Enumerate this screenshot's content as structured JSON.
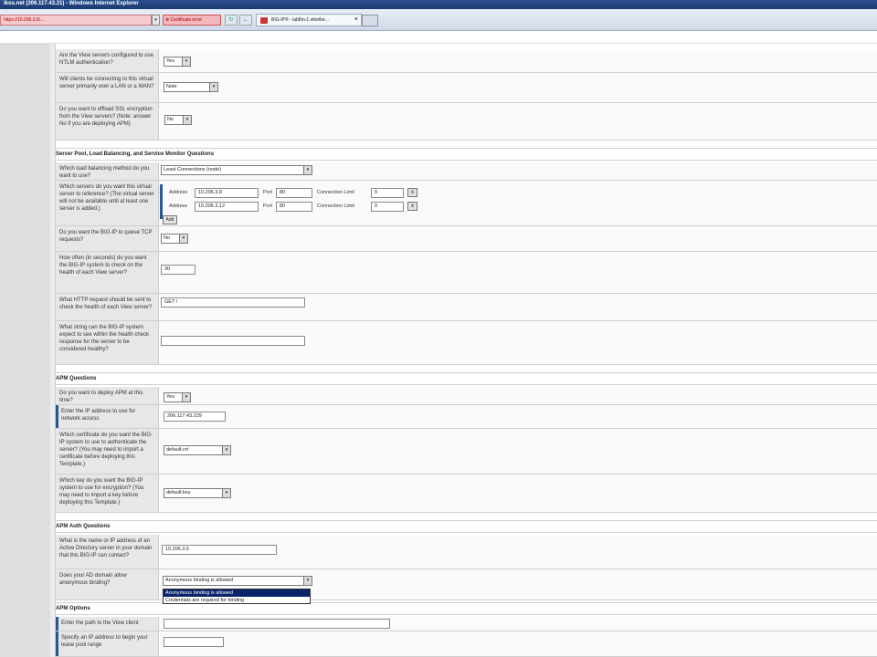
{
  "window": {
    "title": "ikos.net (206.117.43.21) - Windows Internet Explorer"
  },
  "toolbar": {
    "address": "https://10.206.3.5/...",
    "cert_error": "Certificate error",
    "tab_title": "BIG-IP® - lab8m-1.vthelbe...",
    "go_icon": "↻",
    "back_icon": "←"
  },
  "questions": {
    "ntlm": {
      "label": "Are the View servers configured to use NTLM authentication?",
      "value": "Yes"
    },
    "lan_wan": {
      "label": "Will clients be connecting to this virtual server primarily over a LAN or a WAN?",
      "value": "Note"
    },
    "ssl_offload": {
      "label": "Do you want to offload SSL encryption from the View servers? (Note: answer No if you are deploying APM)",
      "value": "No"
    }
  },
  "sections": {
    "pool": "Server Pool, Load Balancing, and Service Monitor Questions",
    "apm": "APM Questions",
    "apm_auth": "APM Auth Questions",
    "apm_options": "APM Options"
  },
  "pool": {
    "lb_method": {
      "label": "Which load balancing method do you want to use?",
      "value": "Least Connections (node)"
    },
    "servers": {
      "label": "Which servers do you want this virtual server to reference? (The virtual server will not be available until at least one server is added.)",
      "address_label": "Address",
      "port_label": "Port",
      "conn_label": "Connection Limit",
      "rows": [
        {
          "address": "10.206.3.8",
          "port": "80",
          "conn": "0"
        },
        {
          "address": "10.206.3.12",
          "port": "80",
          "conn": "0"
        }
      ],
      "add_label": "Add",
      "remove_label": "x"
    },
    "queue": {
      "label": "Do you want the BIG-IP to queue TCP requests?",
      "value": "No"
    },
    "interval": {
      "label": "How often (in seconds) do you want the BIG-IP system to check on the health of each View server?",
      "value": "30"
    },
    "http_request": {
      "label": "What HTTP request should be sent to check the health of each View server?",
      "value": "GET /"
    },
    "receive": {
      "label": "What string can the BIG-IP system expect to see within the health check response for the server to be considered healthy?",
      "value": ""
    }
  },
  "apm": {
    "deploy": {
      "label": "Do you want to deploy APM at this time?",
      "value": "Yes"
    },
    "ip": {
      "label": "Enter the IP address to use for network access",
      "value": "206.117.43.229"
    },
    "cert": {
      "label": "Which certificate do you want the BIG-IP system to use to authenticate the server? (You may need to import a certificate before deploying this Template.)",
      "value": "default.crt"
    },
    "key": {
      "label": "Which key do you want the BIG-IP system to use for encryption? (You may need to import a key before deploying this Template.)",
      "value": "default.key"
    }
  },
  "apm_auth": {
    "ad_server": {
      "label": "What is the name or IP address of an Active Directory server in your domain that this BIG-IP can contact?",
      "value": "10.206.3.5"
    },
    "anon_binding": {
      "label": "Does your AD domain allow anonymous binding?",
      "value": "Anonymous binding is allowed",
      "options": [
        "Anonymous binding is allowed",
        "Credentials are required for binding"
      ]
    }
  },
  "apm_options": {
    "client_path": {
      "label": "Enter the path to the View client",
      "value": ""
    },
    "lease_start": {
      "label": "Specify an IP address to begin your lease pool range",
      "value": ""
    }
  },
  "colors": {
    "accent": "#2c5598",
    "question_bg": "#e7e7e7",
    "selected_option": "#0a246a",
    "cert_error": "#f3b7bd"
  }
}
